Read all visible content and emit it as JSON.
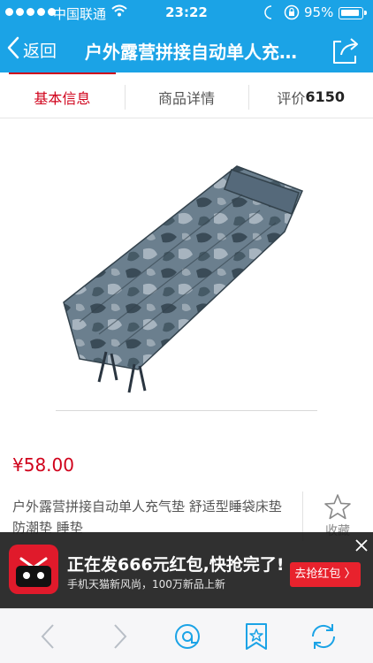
{
  "status_bar": {
    "carrier": "中国联通",
    "time": "23:22",
    "battery": "95%"
  },
  "nav": {
    "back_label": "返回",
    "title": "户外露营拼接自动单人充气垫 舒适型睡袋床垫 防潮垫 睡垫"
  },
  "tabs": {
    "basic_info": "基本信息",
    "details": "商品详情",
    "reviews_label": "评价",
    "reviews_count": "6150"
  },
  "product": {
    "price": "¥58.00",
    "name": "户外露营拼接自动单人充气垫 舒适型睡袋床垫 防潮垫 睡垫",
    "favorite_label": "收藏",
    "image": {
      "name": "camouflage-sleeping-pad",
      "colors": {
        "dark": "#3a4b57",
        "mid": "#6b7f8e",
        "light": "#a7b4bf"
      }
    }
  },
  "promo": {
    "headline": "正在发666元红包,快抢完了!",
    "subtitle": "手机天猫新风尚，100万新品上新",
    "cta": "去抢红包 〉"
  },
  "colors": {
    "header_blue": "#1ba3e6",
    "accent_red": "#d0021b",
    "toolbar_blue": "#1ba3e6"
  }
}
